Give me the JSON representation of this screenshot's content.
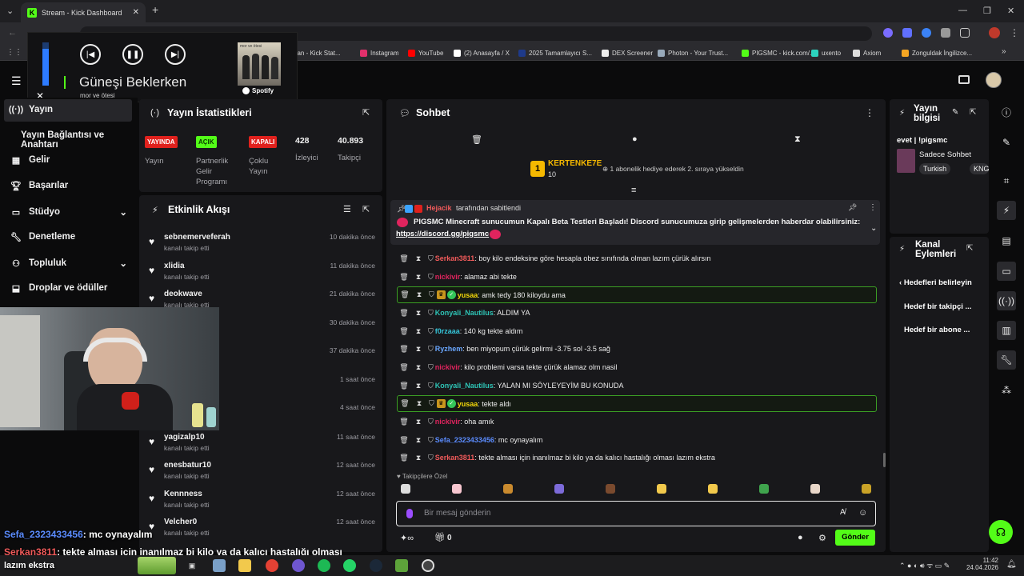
{
  "browser": {
    "tab_title": "Stream - Kick Dashboard",
    "bookmarks": [
      {
        "label": "mican - Kick Stat...",
        "color": "#53fc18"
      },
      {
        "label": "Instagram",
        "color": "#e1306c"
      },
      {
        "label": "YouTube",
        "color": "#ff0000"
      },
      {
        "label": "(2) Anasayfa / X",
        "color": "#ffffff"
      },
      {
        "label": "2025 Tamamlayıcı S...",
        "color": "#1e3a8a"
      },
      {
        "label": "DEX Screener",
        "color": "#eeeeee"
      },
      {
        "label": "Photon - Your Trust...",
        "color": "#9ab"
      },
      {
        "label": "PIGSMC - kick.com/...",
        "color": "#53fc18"
      },
      {
        "label": "uxento",
        "color": "#2dd4bf"
      },
      {
        "label": "Axiom",
        "color": "#dddddd"
      },
      {
        "label": "Zonguldak İngilizce...",
        "color": "#f5a623"
      }
    ]
  },
  "spotify": {
    "track_title": "Güneşi Beklerken",
    "artist": "mor ve ötesi",
    "brand": "Spotify",
    "album_text": "mor ve ötesi"
  },
  "nav": {
    "items": [
      {
        "label": "Yayın",
        "icon": "broadcast-icon"
      },
      {
        "label": "Yayın Bağlantısı ve Anahtarı",
        "icon": ""
      },
      {
        "label": "Gelir",
        "icon": "revenue-icon"
      },
      {
        "label": "Başarılar",
        "icon": "trophy-icon"
      },
      {
        "label": "Stüdyo",
        "icon": "studio-icon"
      },
      {
        "label": "Denetleme",
        "icon": "wrench-icon"
      },
      {
        "label": "Topluluk",
        "icon": "community-icon"
      },
      {
        "label": "Droplar ve ödüller",
        "icon": "drops-icon"
      }
    ]
  },
  "stats": {
    "title": "Yayın İstatistikleri",
    "live_badge": "YAYINDA",
    "live_label": "Yayın",
    "partner_badge": "AÇIK",
    "partner_label": "Partnerlik Gelir Programı",
    "multi_badge": "KAPALI",
    "multi_label": "Çoklu Yayın",
    "viewers": "428",
    "viewers_label": "İzleyici",
    "followers": "40.893",
    "followers_label": "Takipçi"
  },
  "activity": {
    "title": "Etkinlik Akışı",
    "events": [
      {
        "name": "sebnemerveferah",
        "sub": "kanalı takip etti",
        "time": "10 dakika önce"
      },
      {
        "name": "xlidia",
        "sub": "kanalı takip etti",
        "time": "11 dakika önce"
      },
      {
        "name": "deokwave",
        "sub": "kanalı takip etti",
        "time": "21 dakika önce"
      },
      {
        "name": "",
        "sub": "",
        "time": "30 dakika önce"
      },
      {
        "name": "",
        "sub": "",
        "time": "37 dakika önce"
      },
      {
        "name": "",
        "sub": "",
        "time": "1 saat önce"
      },
      {
        "name": "",
        "sub": "",
        "time": "4 saat önce"
      },
      {
        "name": "yagizalp10",
        "sub": "kanalı takip etti",
        "time": "11 saat önce"
      },
      {
        "name": "enesbatur10",
        "sub": "kanalı takip etti",
        "time": "12 saat önce"
      },
      {
        "name": "Kennness",
        "sub": "kanalı takip etti",
        "time": "12 saat önce"
      },
      {
        "name": "Velcher0",
        "sub": "kanalı takip etti",
        "time": "12 saat önce"
      }
    ]
  },
  "chat": {
    "title": "Sohbet",
    "top_gifter": {
      "name": "KERTENKE7E",
      "count": "10",
      "rank": "1",
      "note": "1 abonelik hediye ederek 2. sıraya yükseldin"
    },
    "pinned": {
      "by": "Hejacik",
      "by_suffix": "tarafından sabitlendi",
      "text": "PIGSMC Minecraft sunucumun Kapalı Beta Testleri Başladı! Discord sunucumuza girip gelişmelerden haberdar olabilirsiniz:",
      "link": "https://discord.gg/pigsmc"
    },
    "messages": [
      {
        "user": "Serkan3811",
        "color": "#f05a5a",
        "text": ": boy kilo endeksine göre hesapla obez sınıfında olman lazım çürük alırsın",
        "highlight": false,
        "badges": false
      },
      {
        "user": "nickivir",
        "color": "#e0245e",
        "text": ": alamaz abi tekte",
        "highlight": false,
        "badges": false
      },
      {
        "user": "yusaa",
        "color": "#f5d90a",
        "text": ": amk tedy 180 kiloydu ama",
        "highlight": true,
        "badges": true
      },
      {
        "user": "Konyali_Nautilus",
        "color": "#2ec4b6",
        "text": ": ALDIM YA",
        "highlight": false,
        "badges": false
      },
      {
        "user": "f0rzaaa",
        "color": "#35c4d8",
        "text": ": 140 kg tekte aldım",
        "highlight": false,
        "badges": false
      },
      {
        "user": "Ryzhem",
        "color": "#6aa7ff",
        "text": ": ben miyopum çürük gelirmi -3.75 sol -3.5 sağ",
        "highlight": false,
        "badges": false
      },
      {
        "user": "nickivir",
        "color": "#e0245e",
        "text": ": kilo problemi varsa tekte çürük alamaz olm nasil",
        "highlight": false,
        "badges": false
      },
      {
        "user": "Konyali_Nautilus",
        "color": "#2ec4b6",
        "text": ": YALAN MI SÖYLEYEYİM BU KONUDA",
        "highlight": false,
        "badges": false
      },
      {
        "user": "yusaa",
        "color": "#f5d90a",
        "text": ": tekte aldı",
        "highlight": true,
        "badges": true
      },
      {
        "user": "nickivir",
        "color": "#e0245e",
        "text": ": oha amık",
        "highlight": false,
        "badges": false
      },
      {
        "user": "Sefa_2323433456",
        "color": "#5b8cff",
        "text": ": mc oynayalım",
        "highlight": false,
        "badges": false
      },
      {
        "user": "Serkan3811",
        "color": "#f05a5a",
        "text": ": tekte alması için inanılmaz bi kilo ya da kalıcı hastalığı olması lazım ekstra",
        "highlight": false,
        "badges": false
      }
    ],
    "emote_label": "Takipçilere Özel",
    "input_placeholder": "Bir mesaj gönderin",
    "points": "0",
    "send_label": "Gönder"
  },
  "stream_info": {
    "title": "Yayın bilgisi",
    "stream_title": "evet | !pigsmc",
    "category": "Sadece Sohbet",
    "tags": [
      "Turkish",
      "KNG"
    ]
  },
  "channel_actions": {
    "title": "Kanal Eylemleri",
    "back_label": "Hedefleri belirleyin",
    "items": [
      "Hedef bir takipçi ...",
      "Hedef bir abone ..."
    ]
  },
  "overlay": {
    "line1_user": "Sefa_2323433456",
    "line1_text": ": mc oynayalım",
    "line2_user": "Serkan3811",
    "line2_text": ": tekte alması için inanılmaz bi kilo ya da kalıcı hastalığı olması",
    "line3": "lazım ekstra"
  },
  "taskbar": {
    "time": "11:42",
    "date": "24.04.2026"
  }
}
